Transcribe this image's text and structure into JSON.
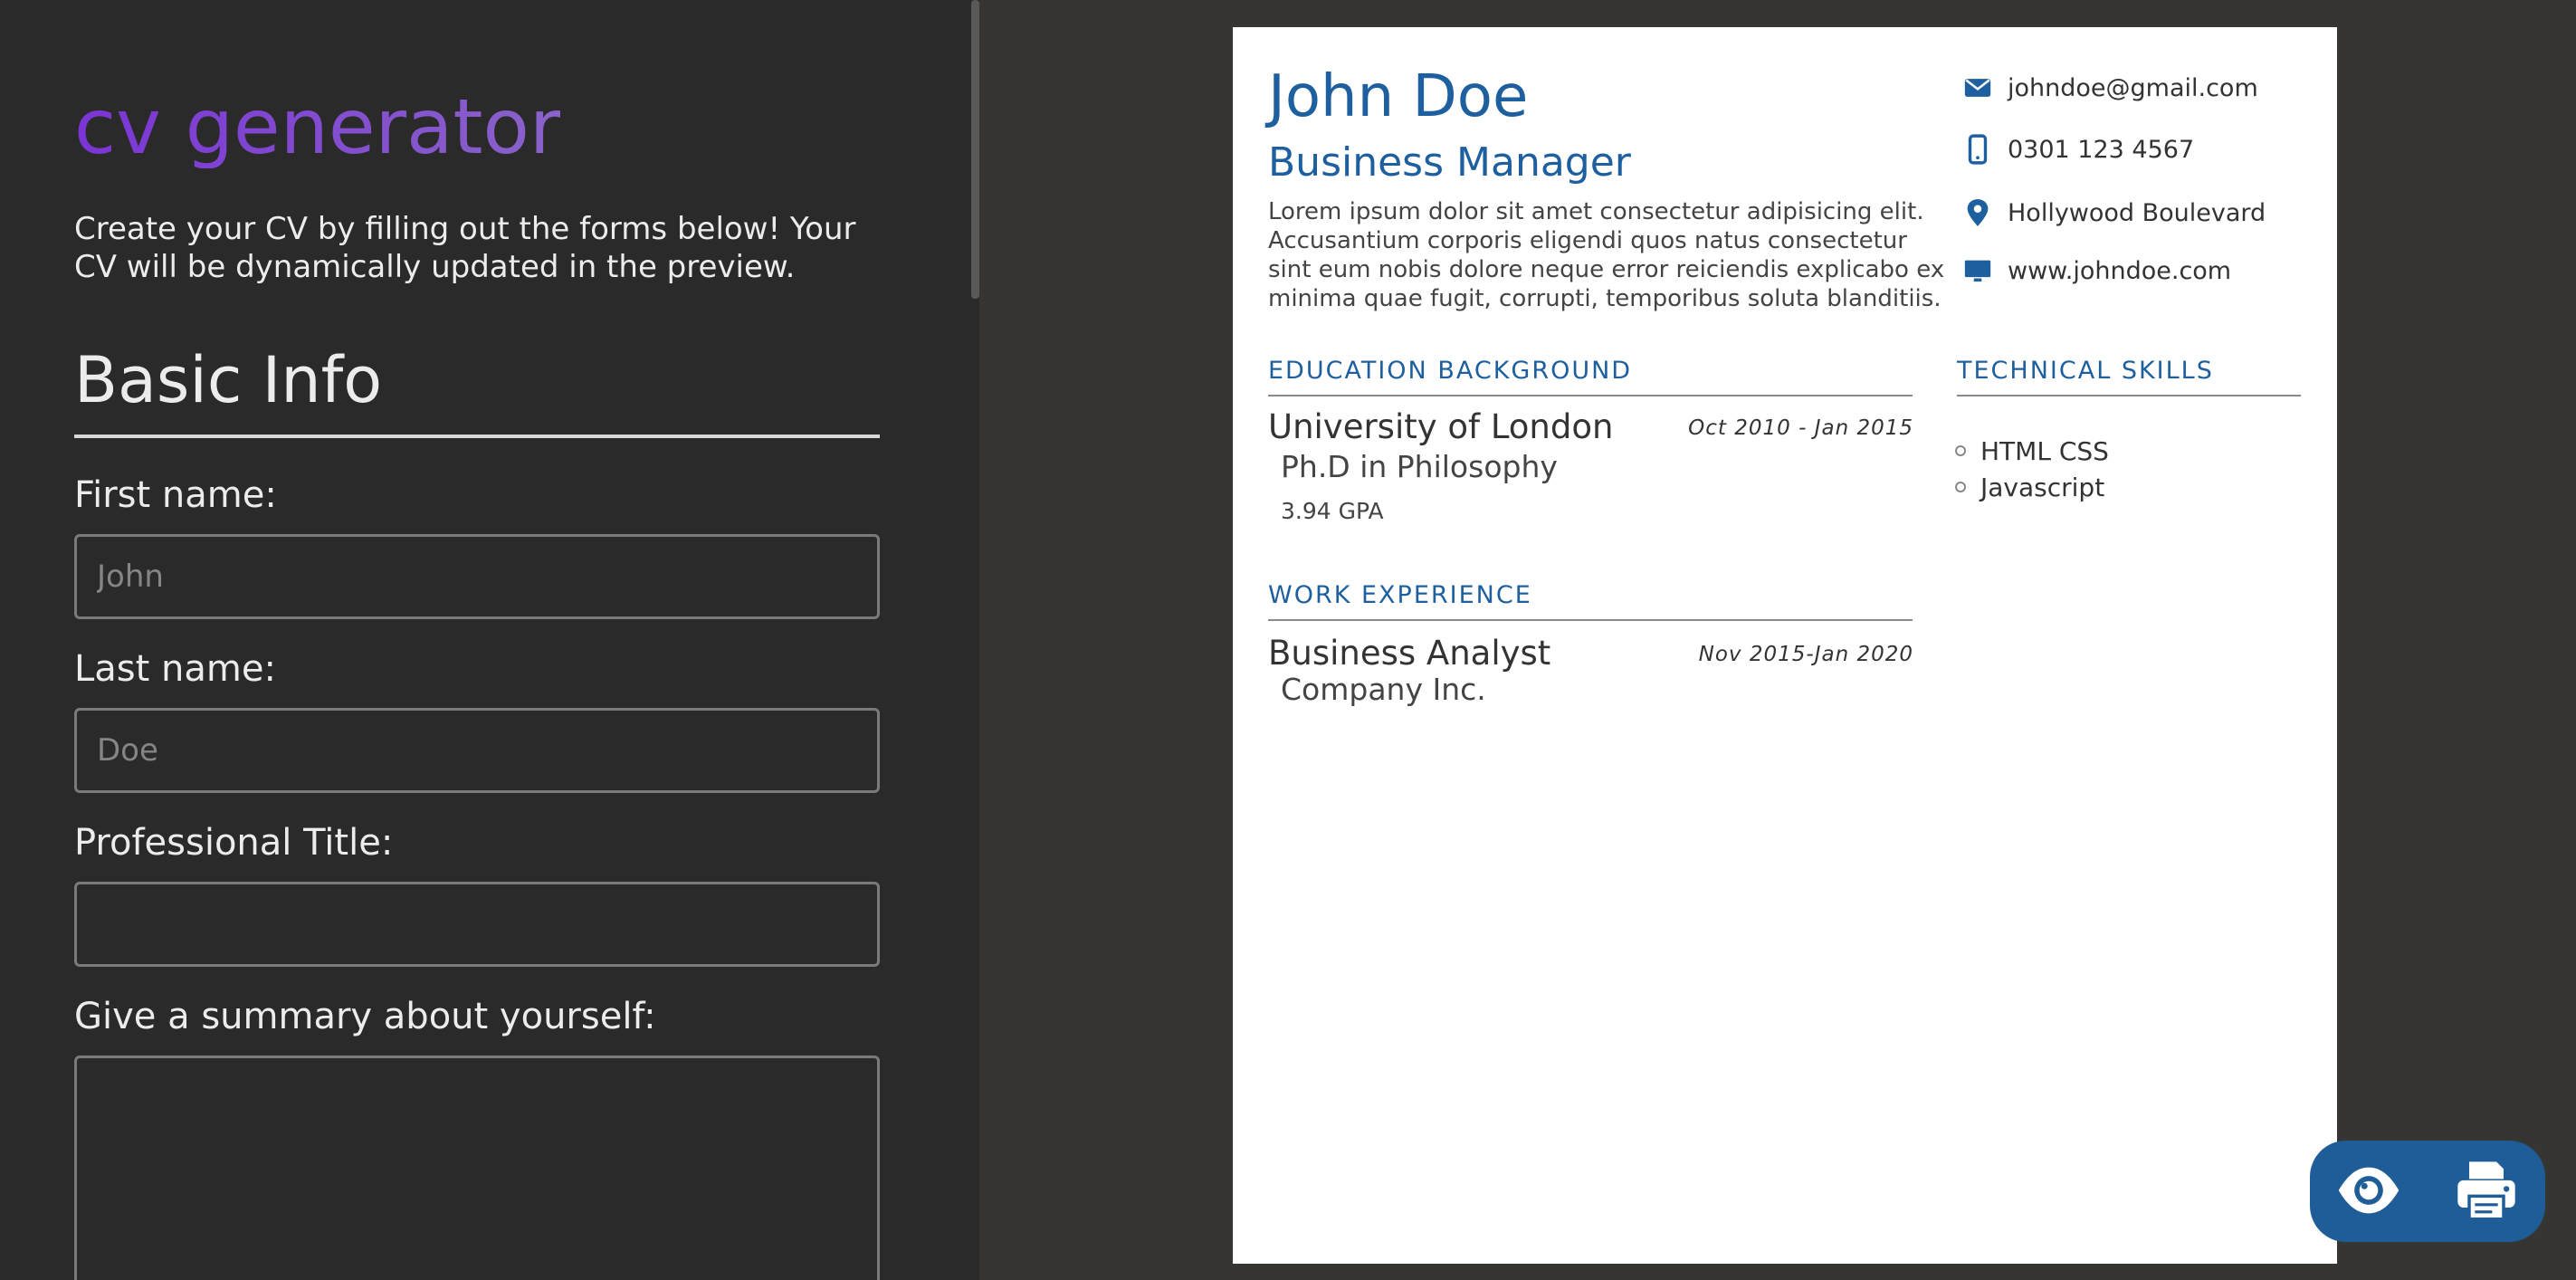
{
  "app": {
    "title": "cv generator",
    "intro": "Create your CV by filling out the forms below! Your CV will be dynamically updated in the preview."
  },
  "form": {
    "section_heading": "Basic Info",
    "fields": {
      "first_name": {
        "label": "First name:",
        "placeholder": "John",
        "value": ""
      },
      "last_name": {
        "label": "Last name:",
        "placeholder": "Doe",
        "value": ""
      },
      "professional_title": {
        "label": "Professional Title:",
        "placeholder": "",
        "value": ""
      },
      "summary": {
        "label": "Give a summary about yourself:",
        "placeholder": "",
        "value": ""
      }
    }
  },
  "cv": {
    "name": "John Doe",
    "title": "Business Manager",
    "summary": "Lorem ipsum dolor sit amet consectetur adipisicing elit. Accusantium corporis eligendi quos natus consectetur sint eum nobis dolore neque error reiciendis explicabo ex minima quae fugit, corrupti, temporibus soluta blanditiis.",
    "contact": {
      "email": {
        "icon": "envelope-icon",
        "text": "johndoe@gmail.com"
      },
      "phone": {
        "icon": "mobile-phone-icon",
        "text": "0301 123 4567"
      },
      "address": {
        "icon": "map-pin-icon",
        "text": "Hollywood Boulevard"
      },
      "website": {
        "icon": "monitor-icon",
        "text": "www.johndoe.com"
      }
    },
    "education": {
      "heading": "EDUCATION BACKGROUND",
      "items": [
        {
          "school": "University of London",
          "degree": "Ph.D in Philosophy",
          "gpa": "3.94 GPA",
          "dates": "Oct 2010 - Jan 2015"
        }
      ]
    },
    "work": {
      "heading": "WORK EXPERIENCE",
      "items": [
        {
          "role": "Business Analyst",
          "company": "Company Inc.",
          "dates": "Nov 2015-Jan 2020"
        }
      ]
    },
    "skills": {
      "heading": "TECHNICAL SKILLS",
      "items": [
        "HTML CSS",
        "Javascript"
      ]
    }
  },
  "actions": {
    "preview_icon": "eye-icon",
    "print_icon": "printer-icon"
  },
  "colors": {
    "accent": "#1d5f9f",
    "title_gradient_start": "#7b34d6",
    "title_gradient_end": "#8a63c9",
    "panel_bg": "#2a2a2a",
    "preview_bg": "#363532",
    "action_bar": "#1e5d97"
  }
}
